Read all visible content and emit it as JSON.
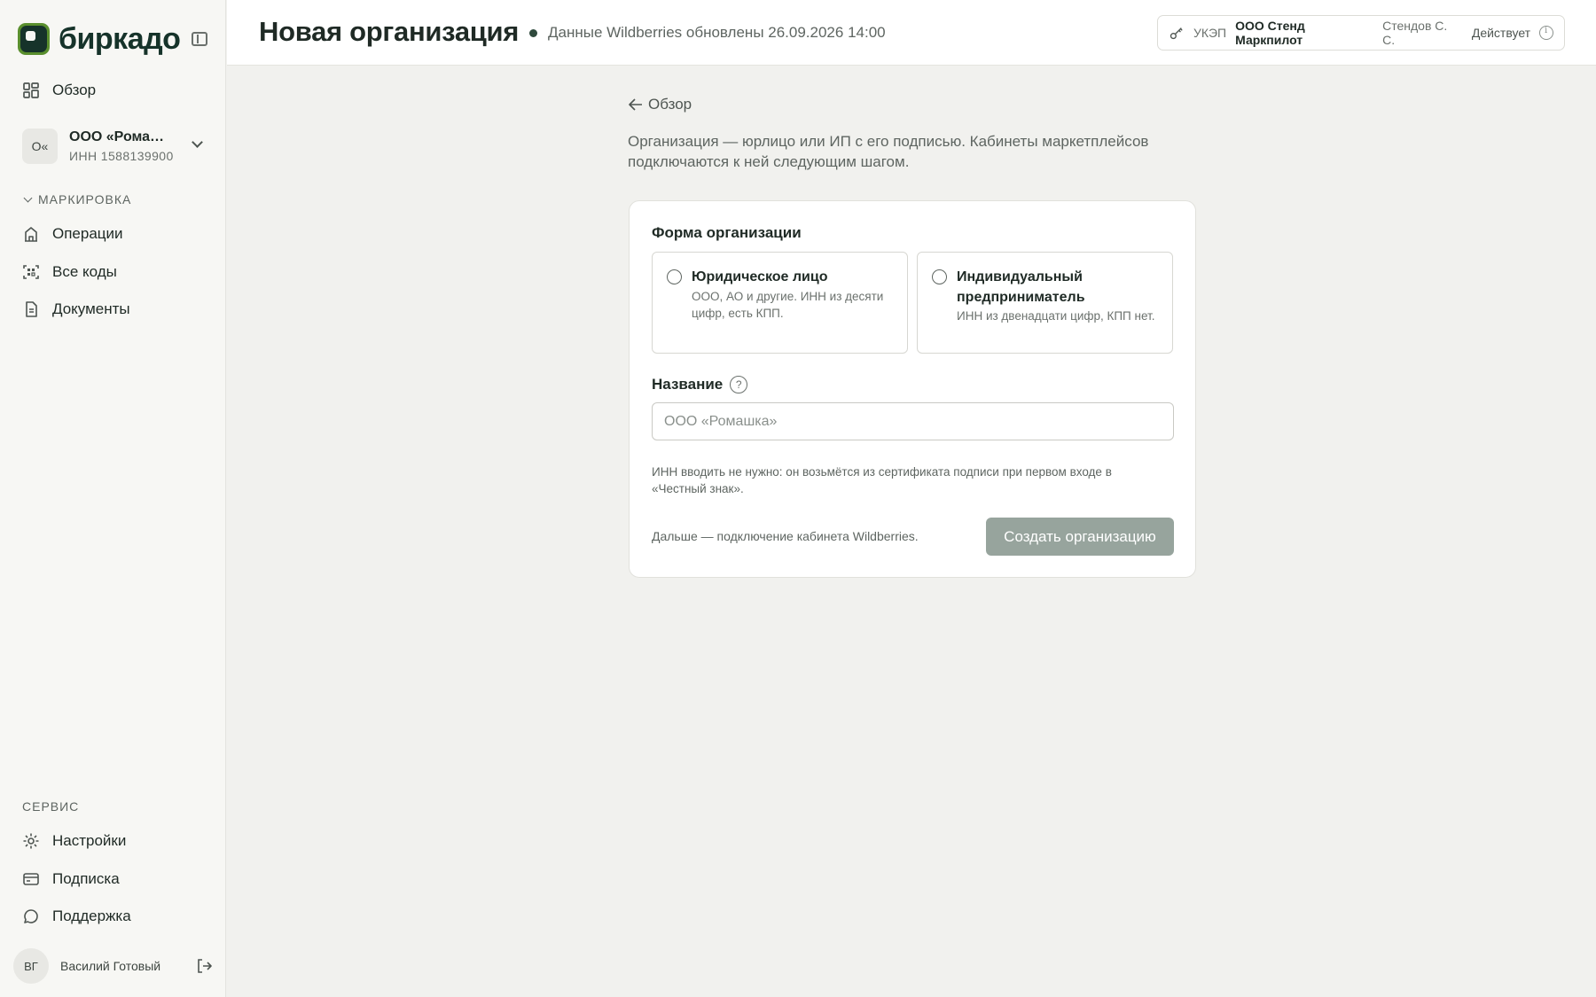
{
  "app": {
    "logo_text": "биркадо",
    "accent": "#16332a",
    "brand_green": "#5a8f2e"
  },
  "header": {
    "title": "Новая организация",
    "status_text": "Данные Wildberries обновлены 26.09.2026 14:00",
    "certificate": {
      "type": "УКЭП",
      "org": "ООО Стенд Маркпилот",
      "person": "Стендов С. С.",
      "state": "Действует"
    }
  },
  "sidebar": {
    "overview": "Обзор",
    "org": {
      "avatar": "О«",
      "name": "ООО «Ромашка»",
      "inn": "ИНН 1588139900"
    },
    "section_marking": "МАРКИРОВКА",
    "items": [
      {
        "label": "Операции",
        "icon": "building-icon"
      },
      {
        "label": "Все коды",
        "icon": "scan-icon"
      },
      {
        "label": "Документы",
        "icon": "document-icon"
      }
    ],
    "section_service": "СЕРВИС",
    "service_items": [
      {
        "label": "Настройки",
        "icon": "gear-icon"
      },
      {
        "label": "Подписка",
        "icon": "card-icon"
      },
      {
        "label": "Поддержка",
        "icon": "chat-icon"
      }
    ],
    "user": {
      "initials": "ВГ",
      "name": "Василий Готовый"
    }
  },
  "main": {
    "back_label": "Обзор",
    "intro": "Организация — юрлицо или ИП с его подписью. Кабинеты маркетплейсов подключаются к ней следующим шагом.",
    "form": {
      "form_label": "Форма организации",
      "options": [
        {
          "title": "Юридическое лицо",
          "desc": "ООО, АО и другие. ИНН из десяти цифр, есть КПП."
        },
        {
          "title": "Индивидуальный предприниматель",
          "desc": "ИНН из двенадцати цифр, КПП нет."
        }
      ],
      "name_label": "Название",
      "help_glyph": "?",
      "name_placeholder": "ООО «Ромашка»",
      "hint": "ИНН вводить не нужно: он возьмётся из сертификата подписи при первом входе в «Честный знак».",
      "next_note": "Дальше — подключение кабинета Wildberries.",
      "submit_label": "Создать организацию"
    }
  }
}
